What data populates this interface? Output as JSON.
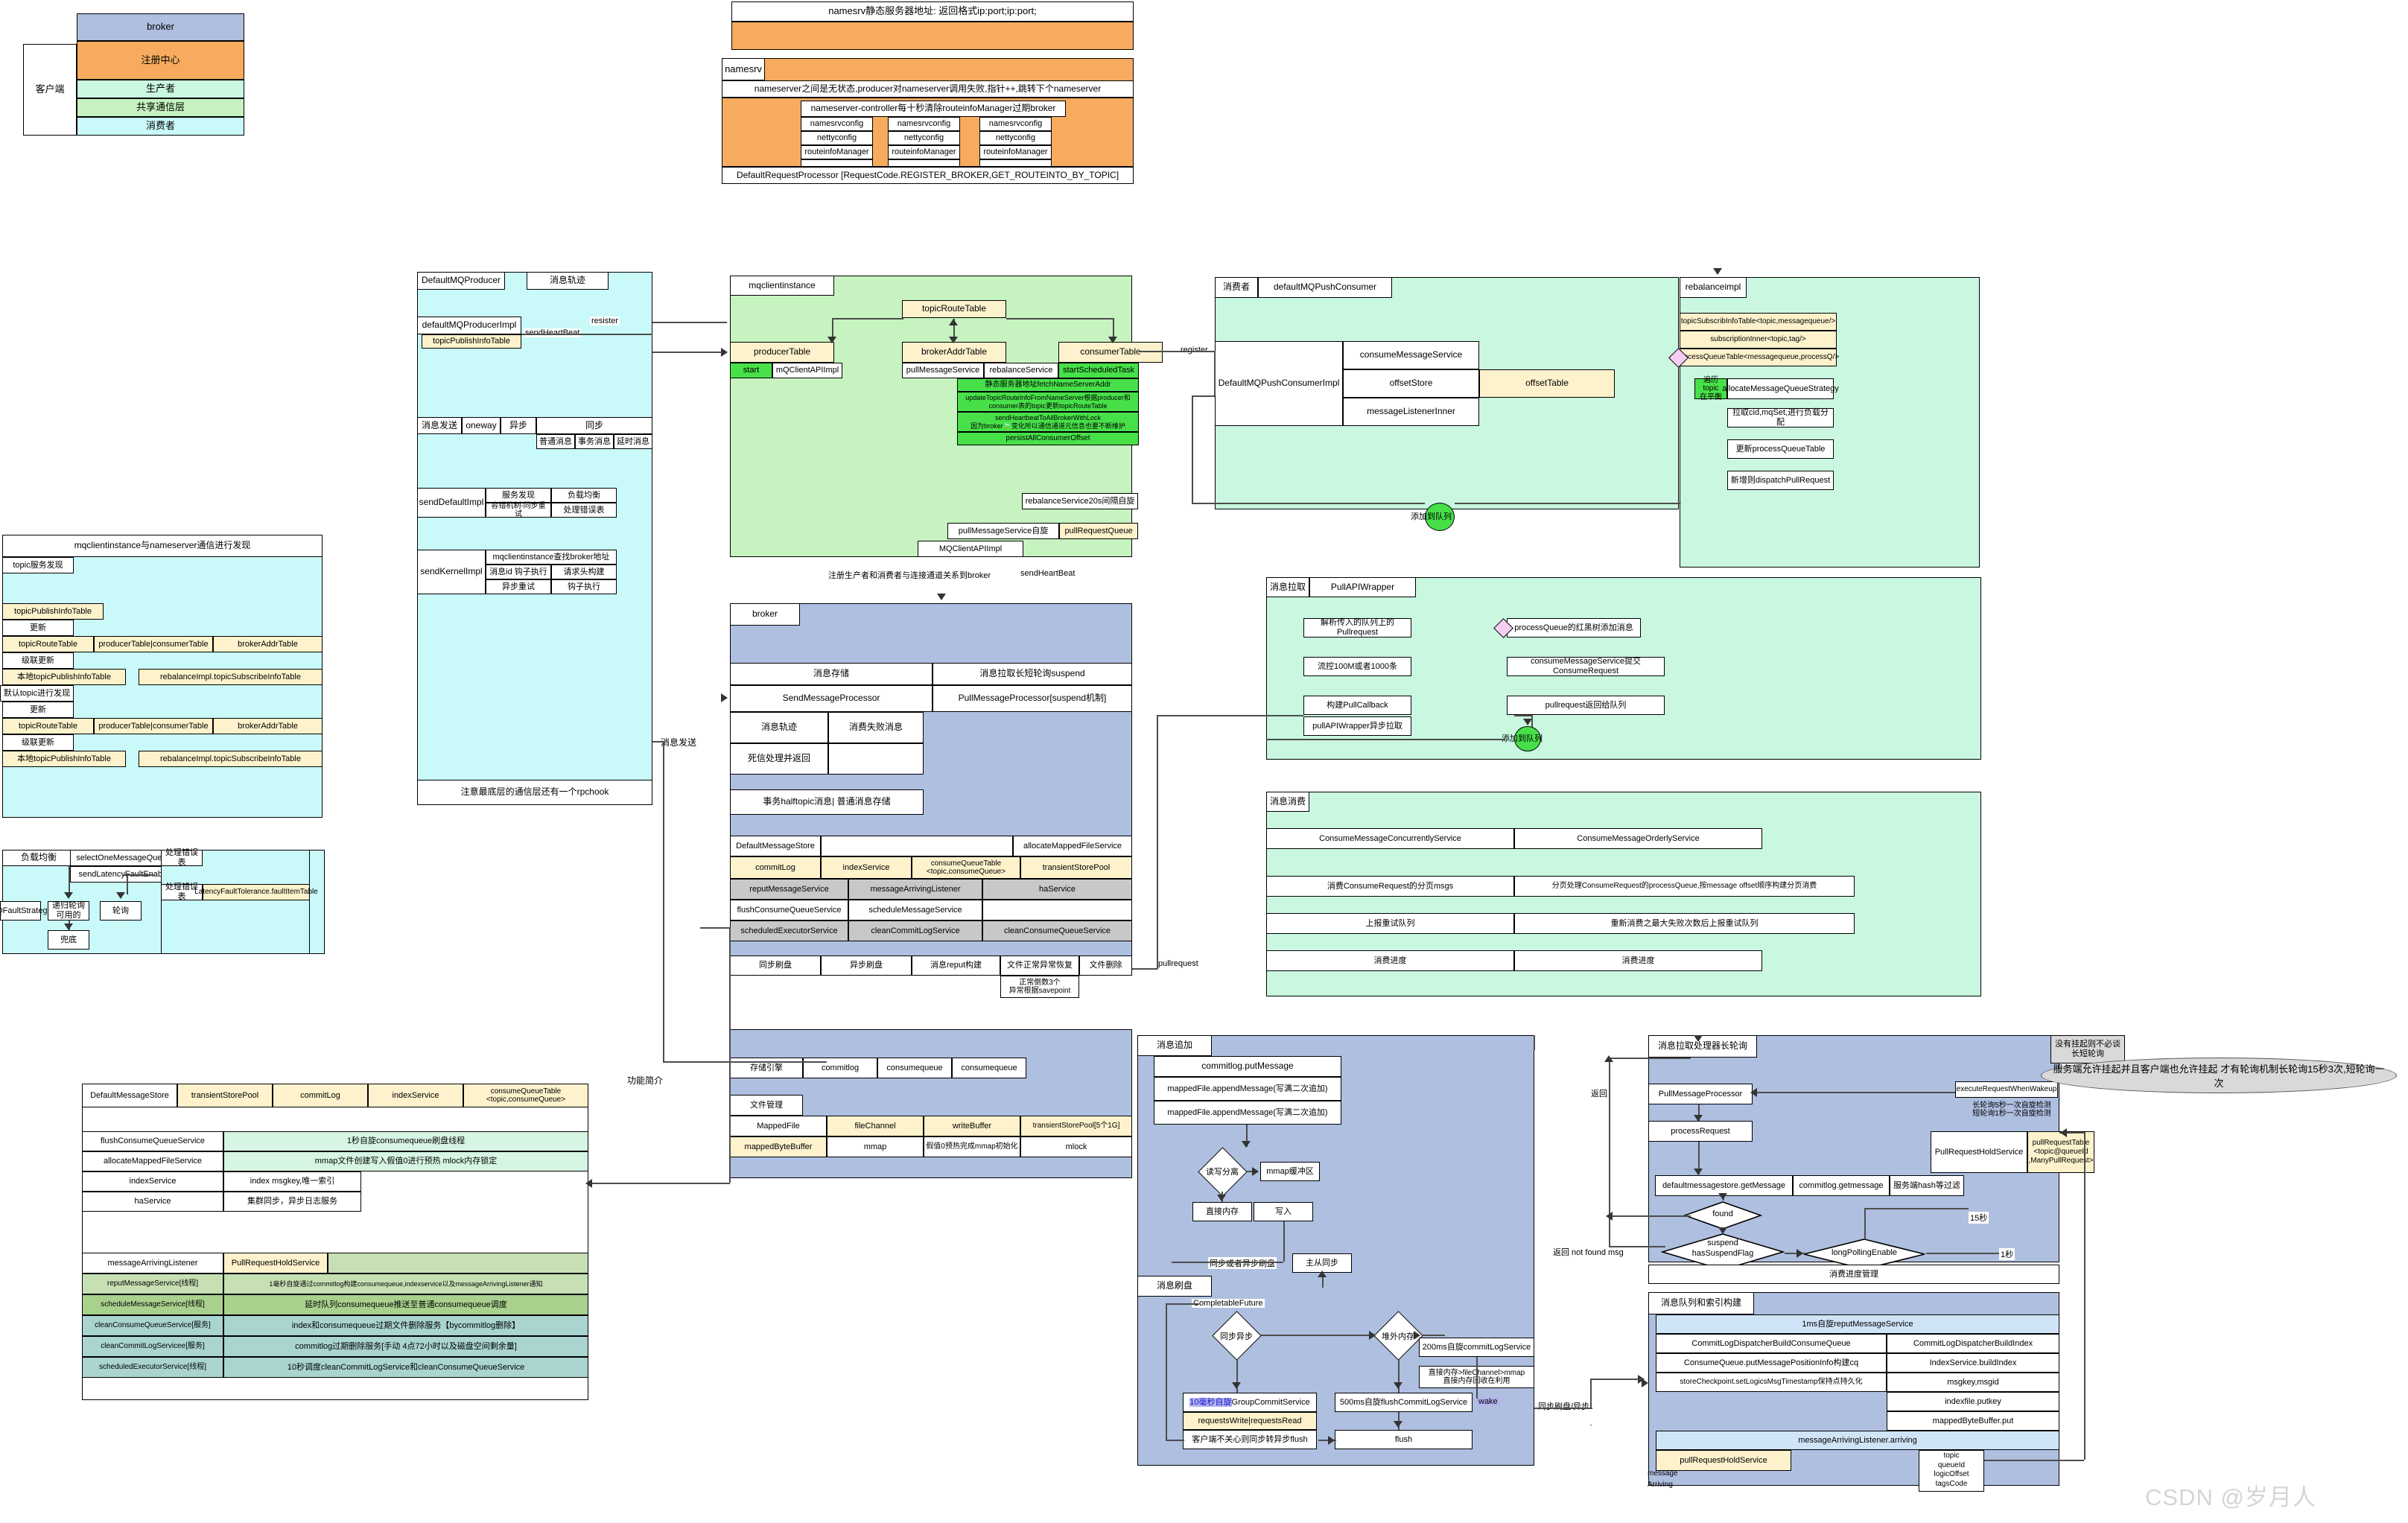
{
  "watermark": "CSDN @岁月人",
  "overview": {
    "client_label": "客户端",
    "layers": [
      "broker",
      "注册中心",
      "生产者",
      "共享通信层",
      "消费者"
    ],
    "colors": {
      "broker": "#aebfe0",
      "registry": "#f7ab5e",
      "producer": "#c9f7e0",
      "shared": "#c6f3bf",
      "consumer": "#caf9f9"
    }
  },
  "namesrv": {
    "header": "namesrv静态服务器地址: 返回格式ip:port;ip:port;",
    "title": "namesrv",
    "stateless_note": "nameserver之间是无状态,producer对nameserver调用失败,指针++,跳转下个nameserver",
    "controller_note": "nameserver-controller每十秒清除routeinfoManager过期broker",
    "columns": [
      [
        "namesrvconfig",
        "nettyconfig",
        "routeinfoManager",
        ""
      ],
      [
        "namesrvconfig",
        "nettyconfig",
        "routeinfoManager",
        ""
      ],
      [
        "namesrvconfig",
        "nettyconfig",
        "routeinfoManager",
        ""
      ]
    ],
    "processor": "DefaultRequestProcessor [RequestCode.REGISTER_BROKER,GET_ROUTEINTO_BY_TOPIC]"
  },
  "producer": {
    "title": "DefaultMQProducer",
    "trace": "消息轨迹",
    "impl": "defaultMQProducerImpl",
    "topic_publish_info_table": "topicPublishInfoTable",
    "send_heartbeat": "sendHeartBeat",
    "resister": "resister",
    "send_row": [
      "消息发送",
      "oneway",
      "异步",
      "同步"
    ],
    "msg_types": [
      "普通消息",
      "事务消息",
      "延时消息"
    ],
    "send_default_impl": "sendDefaultImpl",
    "send_default_cells": [
      "服务发现",
      "负载均衡",
      "容错机制-同步重试",
      "处理错误表"
    ],
    "send_kernel_impl": "sendKernelImpl",
    "send_kernel_top": "mqclientinstance查找broker地址",
    "send_kernel_cells": [
      "消息id 钩子执行",
      "请求头构建",
      "异步重试",
      "钩子执行"
    ],
    "rpchook_note": "注意最底层的通信层还有一个rpchook",
    "send_edge": "消息发送"
  },
  "mqclient": {
    "title": "mqclientinstance",
    "topic_route_table": "topicRouteTable",
    "tables": [
      "producerTable",
      "brokerAddrTable",
      "consumerTable"
    ],
    "services": [
      "start",
      "mQClientAPIImpl",
      "pullMessageService",
      "rebalanceService",
      "startScheduledTask"
    ],
    "scheduled_tasks": [
      "静态服务器地址fetchNameServerAddr",
      "updateTopicRouteInfoFromNameServer根据producer和consumer表的topic更新topicRouteTable",
      "sendHeartbeatToAllBrokerWithLock\n因为broker🍃变化所以通信通道元信息也要不断维护",
      "persistAllConsumerOffset"
    ],
    "rebalance_spin": "rebalanceService20s间隔自旋",
    "pull_spin": "pullMessageService自旋",
    "pull_request_queue": "pullRequestQueue",
    "api_impl": "MQClientAPIImpl",
    "register_note": "注册生产者和消费者与连接通道关系到broker",
    "send_heartbeat": "sendHeartBeat",
    "register_arrow": "register"
  },
  "consumer": {
    "badge": "消费者",
    "title": "defaultMQPushConsumer",
    "impl": "DefaultMQPushConsumerImpl",
    "inner": [
      "consumeMessageService",
      "offsetStore",
      "messageListenerInner"
    ],
    "offset_table": "offsetTable",
    "add_to_queue": "添加到队列"
  },
  "rebalance": {
    "title": "rebalanceimpl",
    "tables": [
      "topicSubscribInfoTable<topic,messagequeue/>",
      "subscriptionInner<topic,tag/>",
      "processQueueTable<messagequeue,processQ/>"
    ],
    "loop_badge": "遍历topic\n在平衡",
    "strategy": "allocateMessageQueueStrategy",
    "steps": [
      "拉取cid,mqSet,进行负载分配",
      "更新processQueueTable",
      "新增则dispatchPullRequest"
    ]
  },
  "pull": {
    "badge": "消息拉取",
    "title": "PullAPIWrapper",
    "left": [
      "解析传入的队列上的Pullrequest",
      "流控100M或者1000条",
      "构建PullCallback",
      "pullAPIWrapper异步拉取"
    ],
    "right": [
      "processQueue的红黑树添加消息",
      "consumeMessageService提交ConsumeRequest",
      "pullrequest返回给队列"
    ],
    "add_to_queue": "添加到队列",
    "pullrequest_label": "pullrequest"
  },
  "consume": {
    "badge": "消息消费",
    "rows": [
      [
        "ConsumeMessageConcurrentlyService",
        "ConsumeMessageOrderlyService"
      ],
      [
        "消费ConsumeRequest的分页msgs",
        "分页处理ConsumeRequest的processQueue,按message offset顺序构建分页消费"
      ],
      [
        "上报重试队列",
        "重新消费之最大失败次数后上报重试队列"
      ],
      [
        "消费进度",
        "消费进度"
      ]
    ]
  },
  "discovery": {
    "title": "mqclientinstance与nameserver通信进行发现",
    "topic_discovery": "topic服务发现",
    "topic_publish_info_table": "topicPublishInfoTable",
    "update": "更新",
    "row_tables": [
      "topicRouteTable",
      "producerTable|consumerTable",
      "brokerAddrTable"
    ],
    "cascade": "级联更新",
    "local": "本地topicPublishInfoTable",
    "rebalance_sub": "rebalanceImpl.topicSubscribeInfoTable",
    "default_discovery": "默认topic进行发现"
  },
  "loadbalance": {
    "badge": "负载均衡",
    "select": "selectOneMessageQueue",
    "latency": "sendLatencyFaultEnable",
    "strategy": "MQFaultStrategy",
    "recursive": "递归轮询可用的",
    "roundrobin": "轮询",
    "fallback": "兜底",
    "err_badge": "处理错误表",
    "err_row": "处理错误表",
    "fault_table": "LatencyFaultTolerance.faultItemTable"
  },
  "broker": {
    "title": "broker",
    "store_header": "消息存储",
    "pull_header": "消息拉取长短轮询suspend",
    "send_processor": "SendMessageProcessor",
    "pull_processor": "PullMessageProcessor[suspend机制]",
    "trace_cells": [
      "消息轨迹",
      "消费失败消息",
      "死信处理并返回",
      ""
    ],
    "halftopic": "事务halftopic消息| 普通消息存储",
    "default_store": "DefaultMessageStore",
    "alloc_service": "allocateMappedFileService",
    "store_cells": [
      "commitLog",
      "indexService",
      "consumeQueueTable\n<topic,consumeQueue>",
      "transientStorePool"
    ],
    "svc_row1": [
      "reputMessageService",
      "messageArrivingListener",
      "haService"
    ],
    "svc_row2": [
      "flushConsumeQueueService",
      "scheduleMessageService",
      ""
    ],
    "svc_row3": [
      "scheduledExecutorService",
      "cleanCommitLogService",
      "cleanConsumeQueueService"
    ],
    "bottom_cells": [
      "同步刷盘",
      "异步刷盘",
      "消息reput构建",
      "文件正常异常恢复",
      "文件删除"
    ],
    "recovery_note": "正常倒数3个\n异常根据savepoint"
  },
  "msgstore": {
    "header": [
      "DefaultMessageStore",
      "transientStorePool",
      "commitLog",
      "indexService",
      "consumeQueueTable\n<topic,consumeQueue>"
    ],
    "rows": [
      {
        "k": "flushConsumeQueueService",
        "v": "1秒自旋consumequeue刷盘线程",
        "c": "#d6f5e3"
      },
      {
        "k": "allocateMappedFileService",
        "v": "mmap文件创建写入假值0进行预热 mlock内存锁定",
        "c": "#d6f5e3"
      },
      {
        "k": "indexService",
        "v": "index msgkey,唯一索引",
        "c": "#fff"
      },
      {
        "k": "haService",
        "v": "集群同步，异步日志服务",
        "c": "#fff"
      }
    ],
    "listener": "messageArrivingListener",
    "hold_service": "PullRequestHoldService",
    "rows2": [
      {
        "k": "reputMessageService[线程]",
        "v": "1毫秒自旋通过commitlog构建consumequeue,indexservice以及messageArrivingListener通知",
        "c": "#c6e0b4"
      },
      {
        "k": "scheduleMessageService[线程]",
        "v": "延时队列consumequeue推送至普通consumequeue调度",
        "c": "#a9d18e"
      },
      {
        "k": "cleanConsumeQueueService[服务]",
        "v": "index和consumequeue过期文件删除服务【bycommitlog删除】",
        "c": "#a9d4d0"
      },
      {
        "k": "cleanCommitLogServicee[服务]",
        "v": "commitlog过期删除服务[手动 4点72小时以及磁盘空间剩余量]",
        "c": "#a9d4d0"
      },
      {
        "k": "scheduledExecutorService[线程]",
        "v": "10秒调度cleanCommitLogService和cleanConsumeQueueService",
        "c": "#a9d4d0"
      }
    ],
    "feature_label": "功能简介"
  },
  "storage": {
    "engine": "存储引擎",
    "engine_cells": [
      "commitlog",
      "consumequeue",
      "consumequeue"
    ],
    "filemgmt": "文件管理",
    "file_row1": [
      "MappedFile",
      "fileChannel",
      "writeBuffer",
      "transientStorePool[5个1G]"
    ],
    "file_row2": [
      "mappedByteBuffer",
      "mmap",
      "假值0预热完成mmap初始化",
      "mlock"
    ]
  },
  "append": {
    "badge": "消息追加",
    "put": "commitlog.putMessage",
    "append1": "mappedFile.appendMessage(写满二次追加)",
    "append2": "mappedFile.appendMessage(写满二次追加)",
    "decision": "读写分离",
    "mmapbuf": "mmap缓冲区",
    "direct": "直接内存",
    "write": "写入",
    "sync_or_async": "同步或者异步刷盘",
    "master_slave": "主从同步"
  },
  "flush": {
    "badge": "消息刷盘",
    "future": "CompletableFuture",
    "d1": "同步异步",
    "d2": "堆外内存",
    "commit200": "200ms自旋commitLogService",
    "memnote": "直接内存>fileChannel>mmap\n直接内存回收在利用",
    "group10": "10毫秒自旋",
    "group_service": "GroupCommitService",
    "requests": "requestsWrite|requestsRead",
    "client_note": "客户端不关心则同步转异步flush",
    "flush500": "500ms自旋flushCommitLogService",
    "wake": "wake",
    "flush": "flush",
    "sync_async_edge": "同步刷盘/异步"
  },
  "longpoll": {
    "badge": "消息拉取处理器长轮询",
    "processor": "PullMessageProcessor",
    "process_request": "processRequest",
    "getmsg": [
      "defaultmessagestore.getMessage",
      "commitlog.getmessage",
      "服务端hash等过滤"
    ],
    "found": "found",
    "suspend": "suspend\nhasSuspendFlag",
    "long_polling": "longPollingEnable",
    "execute_wakeup": "executeRequestWhenWakeup",
    "poll_note": "长轮询5秒一次自旋检测\n短轮询1秒一次自旋检测",
    "hold_service": "PullRequestHoldService",
    "request_table": "pullRequestTable\n<topic@queueId\n,ManyPullRequest>",
    "t15": "15秒",
    "t1": "1秒",
    "ret": "返回",
    "notfound": "返回 not found msg",
    "progress_mgmt": "消费进度管理",
    "note_box": "没有挂起则不必谈\n长短轮询",
    "cloud": "服务端允许挂起并且客户端也允许挂起 才有轮询机制长轮询15秒3次,短轮询一次"
  },
  "queueindex": {
    "badge": "消息队列和索引构建",
    "reput": "1ms自旋reputMessageService",
    "left": [
      "CommitLogDispatcherBuildConsumeQueue",
      "ConsumeQueue.putMessagePositionInfo构建cq",
      "storeCheckpoint.setLogicsMsgTimestamp保持点持久化"
    ],
    "right": [
      "CommitLogDispatcherBuildIndex",
      "IndexService.buildIndex",
      "msgkey,msgid",
      "indexfile.putkey",
      "mappedByteBuffer.put"
    ],
    "arriving": "messageArrivingListener.arriving",
    "hold_service": "pullRequestHoldService",
    "topic_keys": "topic\nqueueId\nlogicOffset\ntagsCode",
    "message": "message",
    "arriving_label": "Arriving"
  }
}
